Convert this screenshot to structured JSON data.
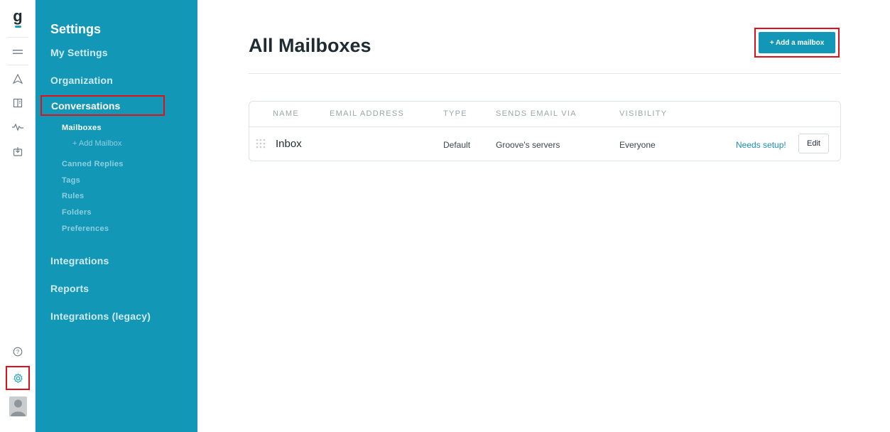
{
  "app": {
    "logo_glyph": "g"
  },
  "rail": {
    "icons": [
      "menu-icon",
      "send-icon",
      "book-icon",
      "activity-icon",
      "inbox-icon",
      "help-icon",
      "gear-icon",
      "avatar"
    ]
  },
  "sidebar": {
    "title": "Settings",
    "sections": [
      {
        "label": "My Settings"
      },
      {
        "label": "Organization"
      },
      {
        "label": "Conversations"
      },
      {
        "label": "Integrations"
      },
      {
        "label": "Reports"
      },
      {
        "label": "Integrations (legacy)"
      }
    ],
    "conversations_items": [
      {
        "label": "Mailboxes"
      },
      {
        "label": "+ Add Mailbox"
      },
      {
        "label": "Canned Replies"
      },
      {
        "label": "Tags"
      },
      {
        "label": "Rules"
      },
      {
        "label": "Folders"
      },
      {
        "label": "Preferences"
      }
    ]
  },
  "main": {
    "title": "All Mailboxes",
    "add_button_label": "+ Add a mailbox",
    "table": {
      "headers": [
        "NAME",
        "EMAIL ADDRESS",
        "TYPE",
        "SENDS EMAIL VIA",
        "VISIBILITY"
      ],
      "rows": [
        {
          "name": "Inbox",
          "email": "",
          "type": "Default",
          "sends_via": "Groove's servers",
          "visibility": "Everyone",
          "status_link": "Needs setup!",
          "edit_label": "Edit"
        }
      ]
    }
  },
  "colors": {
    "sidebar_bg": "#1397b6",
    "accent": "#1b9fbd",
    "highlight": "#e0101a"
  }
}
